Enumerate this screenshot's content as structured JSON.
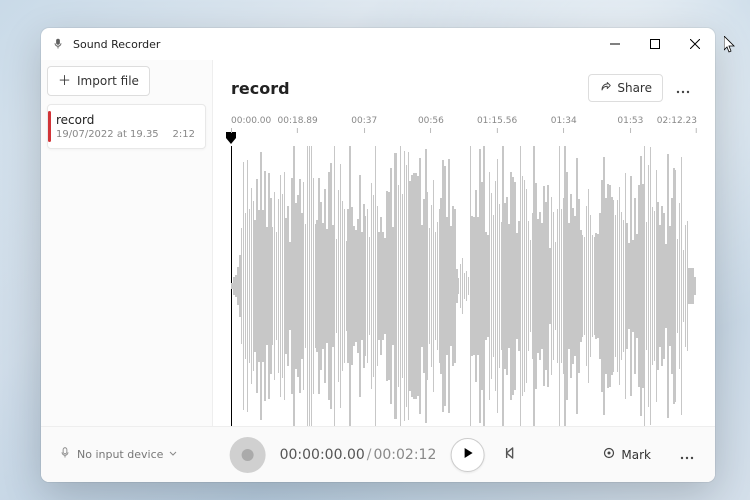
{
  "app": {
    "title": "Sound Recorder"
  },
  "sidebar": {
    "import_label": "Import file",
    "recordings": [
      {
        "name": "record",
        "date": "19/07/2022 at 19.35",
        "duration": "2:12"
      }
    ]
  },
  "main": {
    "title": "record",
    "share_label": "Share"
  },
  "ruler": {
    "ticks": [
      {
        "label": "00:00.00",
        "pos": 0
      },
      {
        "label": "00:18.89",
        "pos": 14.3
      },
      {
        "label": "00:37",
        "pos": 28.6
      },
      {
        "label": "00:56",
        "pos": 42.9
      },
      {
        "label": "01:15.56",
        "pos": 57.1
      },
      {
        "label": "01:34",
        "pos": 71.4
      },
      {
        "label": "01:53",
        "pos": 85.7
      },
      {
        "label": "02:12.23",
        "pos": 100
      }
    ]
  },
  "footer": {
    "device_label": "No input device",
    "current_time": "00:00:00.00",
    "total_time": "00:02:12",
    "mark_label": "Mark"
  },
  "icons": {
    "mic": "mic-icon",
    "plus": "plus-icon",
    "share": "share-icon",
    "more": "more-icon",
    "play": "play-icon",
    "rewind": "rewind-icon",
    "marker": "marker-icon",
    "chevron": "chevron-down-icon"
  }
}
